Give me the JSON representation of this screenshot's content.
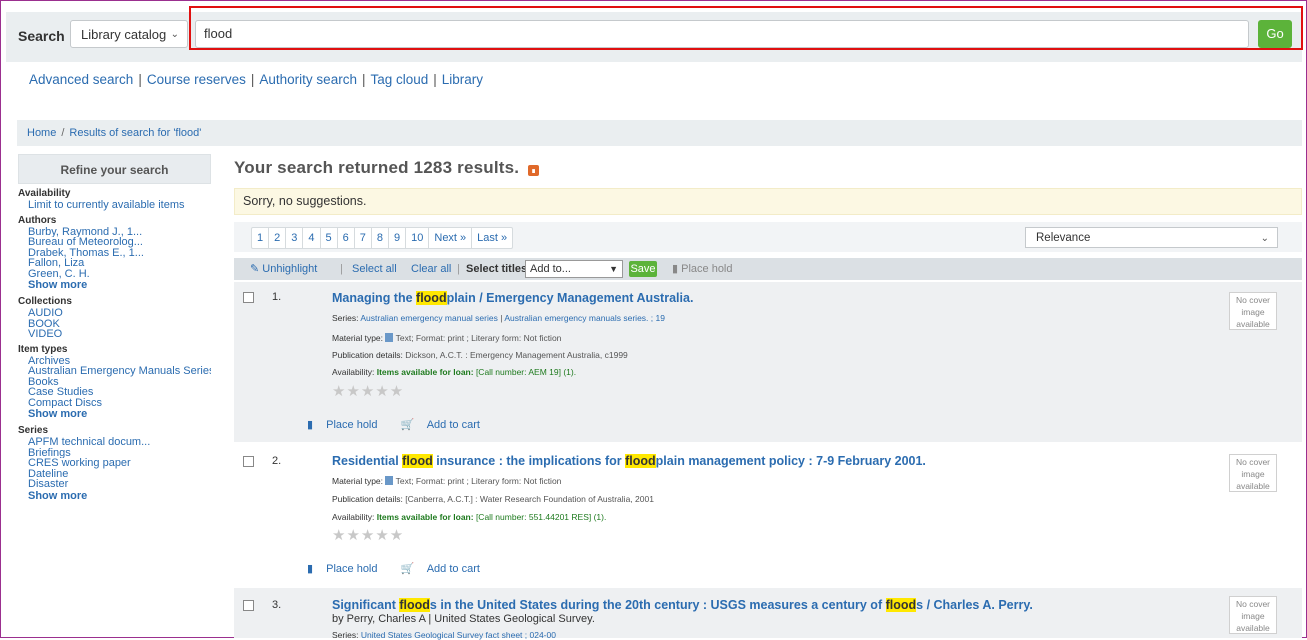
{
  "header": {
    "search_label": "Search",
    "catalog_option": "Library catalog",
    "query": "flood",
    "go_label": "Go"
  },
  "more_searches": [
    "Advanced search",
    "Course reserves",
    "Authority search",
    "Tag cloud",
    "Library"
  ],
  "breadcrumb": {
    "home": "Home",
    "current": "Results of search for 'flood'"
  },
  "facets": {
    "title": "Refine your search",
    "availability": {
      "head": "Availability",
      "items": [
        "Limit to currently available items"
      ]
    },
    "authors": {
      "head": "Authors",
      "items": [
        "Burby, Raymond J., 1...",
        "Bureau of Meteorolog...",
        "Drabek, Thomas E., 1...",
        "Fallon, Liza",
        "Green, C. H."
      ],
      "more": "Show more"
    },
    "collections": {
      "head": "Collections",
      "items": [
        "AUDIO",
        "BOOK",
        "VIDEO"
      ]
    },
    "item_types": {
      "head": "Item types",
      "items": [
        "Archives",
        "Australian Emergency Manuals Series",
        "Books",
        "Case Studies",
        "Compact Discs"
      ],
      "more": "Show more"
    },
    "series": {
      "head": "Series",
      "items": [
        "APFM technical docum...",
        "Briefings",
        "CRES working paper",
        "Dateline",
        "Disaster"
      ],
      "more": "Show more"
    }
  },
  "results": {
    "title": "Your search returned 1283 results.",
    "suggestions": "Sorry, no suggestions.",
    "pages": [
      "1",
      "2",
      "3",
      "4",
      "5",
      "6",
      "7",
      "8",
      "9",
      "10",
      "Next »",
      "Last »"
    ],
    "sort": "Relevance",
    "toolbar": {
      "unhighlight": "Unhighlight",
      "select_all": "Select all",
      "clear_all": "Clear all",
      "select_titles": "Select titles to:",
      "add_to": "Add to...",
      "save": "Save",
      "place_hold": "Place hold"
    },
    "nocover": [
      "No cover",
      "image",
      "available"
    ],
    "stars": "★★★★★",
    "items": [
      {
        "num": "1.",
        "title_a": "Managing the ",
        "title_mark": "flood",
        "title_b": "plain / Emergency Management Australia.",
        "series_label": "Series: ",
        "series_a": "Australian emergency manual series",
        "series_sep": " | ",
        "series_b": "Australian emergency manuals series. ; 19",
        "material": "Material type: ",
        "material_b": " Text; Format: print ; Literary form: Not fiction",
        "pub": "Publication details: ",
        "pub_b": "Dickson, A.C.T. : Emergency Management Australia, c1999",
        "avail": "Availability: ",
        "avail_g": "Items available for loan:",
        "avail_b": " [Call number: AEM 19] (1).",
        "place_hold": "Place hold",
        "add_cart": "Add to cart"
      },
      {
        "num": "2.",
        "title_a": "Residential ",
        "title_mark": "flood",
        "title_b": " insurance : the implications for ",
        "title_mark2": "flood",
        "title_c": "plain management policy : 7-9 February 2001.",
        "material": "Material type: ",
        "material_b": " Text; Format: print ; Literary form: Not fiction",
        "pub": "Publication details: ",
        "pub_b": "[Canberra, A.C.T.] : Water Research Foundation of Australia, 2001",
        "avail": "Availability: ",
        "avail_g": "Items available for loan:",
        "avail_b": " [Call number: 551.44201 RES] (1).",
        "place_hold": "Place hold",
        "add_cart": "Add to cart"
      },
      {
        "num": "3.",
        "title_a": "Significant ",
        "title_mark": "flood",
        "title_b": "s in the United States during the 20th century : USGS measures a century of ",
        "title_mark2": "flood",
        "title_c": "s / Charles A. Perry.",
        "byline": "by Perry, Charles A | United States Geological Survey.",
        "series_label": "Series: ",
        "series_a": "United States Geological Survey fact sheet ; 024-00"
      }
    ]
  }
}
